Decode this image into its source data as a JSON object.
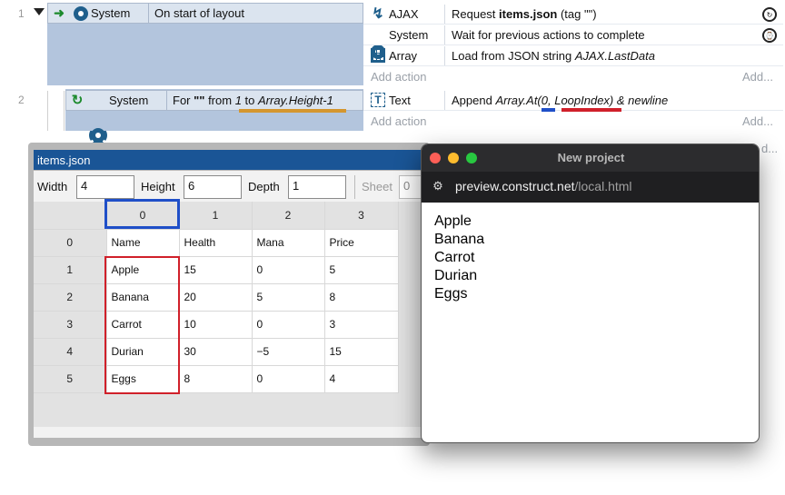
{
  "event_sheet": {
    "events": [
      {
        "number": "1",
        "condition": {
          "object": "System",
          "text": "On start of layout"
        },
        "actions": [
          {
            "icon": "ajax-icon",
            "object": "AJAX",
            "text_parts": [
              {
                "t": "Request ",
                "s": "n"
              },
              {
                "t": "items.json",
                "s": "b"
              },
              {
                "t": " (tag \"\")",
                "s": "n"
              }
            ]
          },
          {
            "icon": "gear-icon",
            "object": "System",
            "text_parts": [
              {
                "t": "Wait for previous actions to complete",
                "s": "n"
              }
            ]
          },
          {
            "icon": "array-icon",
            "object": "Array",
            "text_parts": [
              {
                "t": "Load from JSON string ",
                "s": "n"
              },
              {
                "t": "AJAX.LastData",
                "s": "i"
              }
            ]
          }
        ],
        "add_action": "Add action",
        "add_short": "Add..."
      },
      {
        "number": "2",
        "condition": {
          "object": "System",
          "text_parts": [
            {
              "t": "For ",
              "s": "n"
            },
            {
              "t": "\"\"",
              "s": "b"
            },
            {
              "t": " from ",
              "s": "n"
            },
            {
              "t": "1",
              "s": "i"
            },
            {
              "t": " to ",
              "s": "n"
            },
            {
              "t": "Array.Height-1",
              "s": "i"
            }
          ]
        },
        "actions": [
          {
            "icon": "text-icon",
            "object": "Text",
            "text_parts": [
              {
                "t": "Append ",
                "s": "n"
              },
              {
                "t": "Array.At(0, LoopIndex) & newline",
                "s": "i"
              }
            ]
          }
        ],
        "add_action": "Add action",
        "add_short": "Add...",
        "add_short_cut": "d..."
      }
    ]
  },
  "array_editor": {
    "title": "items.json",
    "width_label": "Width",
    "width_value": "4",
    "height_label": "Height",
    "height_value": "6",
    "depth_label": "Depth",
    "depth_value": "1",
    "sheet_label": "Sheet",
    "sheet_value": "0",
    "col_headers": [
      "0",
      "1",
      "2",
      "3"
    ],
    "rows": [
      {
        "index": "0",
        "cells": [
          "Name",
          "Health",
          "Mana",
          "Price"
        ]
      },
      {
        "index": "1",
        "cells": [
          "Apple",
          "15",
          "0",
          "5"
        ]
      },
      {
        "index": "2",
        "cells": [
          "Banana",
          "20",
          "5",
          "8"
        ]
      },
      {
        "index": "3",
        "cells": [
          "Carrot",
          "10",
          "0",
          "3"
        ]
      },
      {
        "index": "4",
        "cells": [
          "Durian",
          "30",
          "−5",
          "15"
        ]
      },
      {
        "index": "5",
        "cells": [
          "Eggs",
          "8",
          "0",
          "4"
        ]
      }
    ]
  },
  "preview_window": {
    "title": "New project",
    "url_host": "preview.construct.net",
    "url_path": "/local.html",
    "lines": [
      "Apple",
      "Banana",
      "Carrot",
      "Durian",
      "Eggs"
    ]
  },
  "colors": {
    "event_bg": "#b3c5dd",
    "action_bg": "#dbe4ef",
    "editor_title": "#1a5596",
    "highlight_blue": "#1f4fc8",
    "highlight_red": "#d0202a",
    "underline_orange": "#d4962e"
  }
}
